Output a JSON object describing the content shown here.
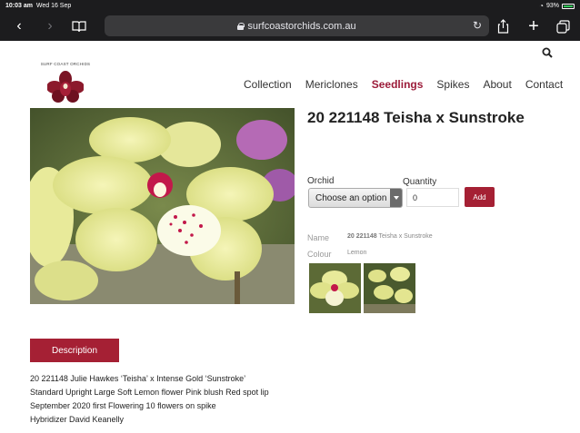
{
  "status": {
    "time": "10:03 am",
    "date": "Wed 16 Sep",
    "battery": "93%"
  },
  "browser": {
    "url": "surfcoastorchids.com.au"
  },
  "site": {
    "logo_text": "SURF COAST ORCHIDS"
  },
  "nav": {
    "items": [
      {
        "label": "Collection"
      },
      {
        "label": "Mericlones"
      },
      {
        "label": "Seedlings"
      },
      {
        "label": "Spikes"
      },
      {
        "label": "About"
      },
      {
        "label": "Contact"
      }
    ]
  },
  "product": {
    "title": "20 221148 Teisha x Sunstroke",
    "orchid_label": "Orchid",
    "quantity_label": "Quantity",
    "select_value": "Choose an option",
    "quantity_value": "0",
    "add_label": "Add",
    "name_label": "Name",
    "name_code": "20 221148",
    "name_value": "Teisha x Sunstroke",
    "colour_label": "Colour",
    "colour_value": "Lemon"
  },
  "description": {
    "tab_label": "Description",
    "lines": [
      "20 221148 Julie Hawkes ‘Teisha’ x Intense Gold ‘Sunstroke’",
      "Standard Upright Large Soft Lemon flower Pink blush Red spot lip",
      "September 2020 first Flowering 10 flowers on spike",
      "Hybridizer David Keanelly"
    ]
  },
  "colors": {
    "accent": "#a52034",
    "nav_active": "#9c1c3a",
    "chrome": "#1c1c1e"
  }
}
